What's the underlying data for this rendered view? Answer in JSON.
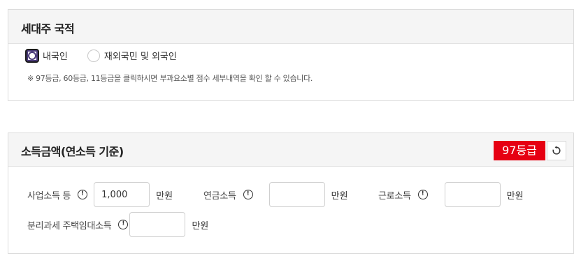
{
  "household": {
    "title": "세대주 국적",
    "options": [
      {
        "label": "내국인",
        "selected": true
      },
      {
        "label": "재외국민 및 외국인",
        "selected": false
      }
    ],
    "note": "※ 97등급, 60등급, 11등급을 클릭하시면 부과요소별 점수 세부내역을 확인 할 수 있습니다."
  },
  "income": {
    "title": "소득금액(연소득 기준)",
    "grade": "97등급",
    "grade_color": "#e60012",
    "refresh_icon": "refresh-icon",
    "fields": [
      {
        "label": "사업소득 등",
        "value": "1,000",
        "unit": "만원"
      },
      {
        "label": "연금소득",
        "value": "",
        "unit": "만원"
      },
      {
        "label": "근로소득",
        "value": "",
        "unit": "만원"
      },
      {
        "label": "분리과세 주택임대소득",
        "value": "",
        "unit": "만원"
      }
    ]
  }
}
